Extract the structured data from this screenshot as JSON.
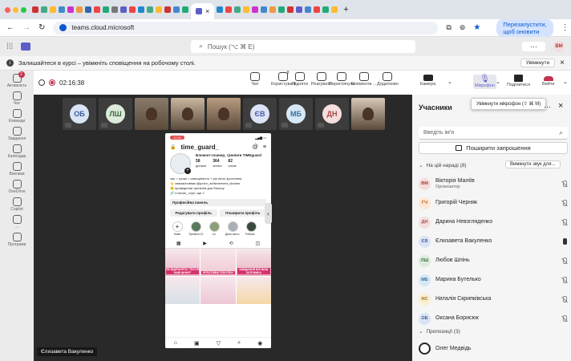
{
  "browser": {
    "tab_title_hint": "",
    "url": "teams.cloud.microsoft",
    "relaunch_label": "Перезапустити, щоб оновити"
  },
  "teams": {
    "search_placeholder": "Пошук (⌥ ⌘ E)",
    "user_initials": "ВМ"
  },
  "banner": {
    "text": "Залишайтеся в курсі – увімкніть сповіщення на робочому столі.",
    "button": "Увімкнути"
  },
  "rail": [
    {
      "label": "Активність",
      "icon": "bell-icon",
      "badge": "2"
    },
    {
      "label": "Чат",
      "icon": "chat-icon"
    },
    {
      "label": "Команди",
      "icon": "teams-icon"
    },
    {
      "label": "Завдання",
      "icon": "tasks-icon"
    },
    {
      "label": "Календар",
      "icon": "calendar-icon"
    },
    {
      "label": "Виклики",
      "icon": "phone-icon"
    },
    {
      "label": "OneDrive",
      "icon": "cloud-icon"
    },
    {
      "label": "Copilot",
      "icon": "copilot-icon"
    },
    {
      "label": "...",
      "icon": "more-icon"
    },
    {
      "label": "Програми",
      "icon": "apps-icon"
    }
  ],
  "meeting": {
    "timer": "02:16:38",
    "controls": [
      {
        "label": "Чат",
        "icon": "chat-icon"
      },
      {
        "label": "Користувачі",
        "icon": "people-icon",
        "count": "8"
      },
      {
        "label": "Підняти",
        "icon": "hand-icon"
      },
      {
        "label": "Реагувати",
        "icon": "smile-icon"
      },
      {
        "label": "Переглянути",
        "icon": "view-icon"
      },
      {
        "label": "Елементи ...",
        "icon": "apps-icon"
      },
      {
        "label": "Додатково",
        "icon": "more-icon"
      }
    ],
    "thumbnails": [
      {
        "initials": "ОБ",
        "color": "#d9e4f5",
        "text_color": "#3b5b9a"
      },
      {
        "initials": "ЛШ",
        "color": "#dcebdc",
        "text_color": "#3b6b3b"
      },
      {
        "initials": "",
        "video": true
      },
      {
        "initials": "",
        "video": true
      },
      {
        "initials": "",
        "video": true
      },
      {
        "initials": "ЄВ",
        "color": "#dce3f5",
        "text_color": "#4b5fa5"
      },
      {
        "initials": "МБ",
        "color": "#d6e8f5",
        "text_color": "#3a6f9a"
      },
      {
        "initials": "ДН",
        "color": "#f5dede",
        "text_color": "#a54848"
      },
      {
        "initials": "",
        "video": true
      }
    ],
    "speaker_name": "Єлизавета Вакуленко",
    "share": {
      "username": "time_guard_",
      "bio_title": "Блокнот-планер, тренінги ТІМЕguard",
      "stats": [
        {
          "n": "58",
          "l": "дописи"
        },
        {
          "n": "364",
          "l": "читачі"
        },
        {
          "n": "82",
          "l": "читає"
        }
      ],
      "bio_lines": [
        "час = гроші = самоцінність + рік твого зростання",
        "👆 співзасновник @junior_achievement_ukraine",
        "🙂 проведення тренінгів для бізнесу",
        "🔗 t.me/ukr_vvyk і ще 2"
      ],
      "panel_title": "Професійна панель",
      "btn_edit": "Редагувати профіль",
      "btn_share": "Поширити профіль",
      "highlights": [
        "Нове",
        "Тренінги 21",
        "Ш",
        "День місто..",
        "Робоче..."
      ],
      "post_texts": [
        "ЯК ВІДРІЗНЯТИ \"ПУСТЕ НАВЧАННЯ\"",
        "КРЕАТИВНІ ПОКУПКИ",
        "ЗАВДАННЯ ВІЗ ВАШ ЗАТРИМКА"
      ]
    }
  },
  "toolbar_right": {
    "camera": "Камера",
    "mic": "Мікрофон",
    "share": "Поділитися",
    "leave": "Вийти",
    "tooltip": "Увімкнути мікрофон (⇧ ⌘ M)"
  },
  "participants": {
    "title": "Учасники",
    "search_placeholder": "Введіть ім'я",
    "share_invite": "Поширити запрошення",
    "in_meeting_label": "На цій нараді (8)",
    "mute_all": "Вимкнути звук для...",
    "suggested_label": "Пропозиції (3)",
    "people": [
      {
        "initials": "ВМ",
        "name": "Вікторія Маліїв",
        "sub": "Організатор",
        "color": "#f5dcdc",
        "text": "#a53d3d",
        "mic": "off"
      },
      {
        "initials": "ГЧ",
        "name": "Григорій Черняк",
        "color": "#fde6d3",
        "text": "#b35a16",
        "mic": "off"
      },
      {
        "initials": "ДН",
        "name": "Дарина Невзгляденко",
        "color": "#f5dede",
        "text": "#a54848",
        "mic": "off"
      },
      {
        "initials": "ЄВ",
        "name": "Єлизавета Вакуленко",
        "color": "#dce3f5",
        "text": "#4b5fa5",
        "mic": "on"
      },
      {
        "initials": "ЛШ",
        "name": "Любов Шпінь",
        "color": "#dcebdc",
        "text": "#3b6b3b",
        "mic": "off"
      },
      {
        "initials": "МБ",
        "name": "Марина Бутелько",
        "color": "#d6e8f5",
        "text": "#3a6f9a",
        "mic": "off"
      },
      {
        "initials": "НС",
        "name": "Наталія Скрипківська",
        "color": "#fbeed2",
        "text": "#9a6a10",
        "mic": "off"
      },
      {
        "initials": "ОБ",
        "name": "Оксана Борисюк",
        "color": "#d9e4f5",
        "text": "#3b5b9a",
        "mic": "off"
      }
    ],
    "suggested": [
      {
        "name": "Олег Медвідь"
      }
    ]
  }
}
